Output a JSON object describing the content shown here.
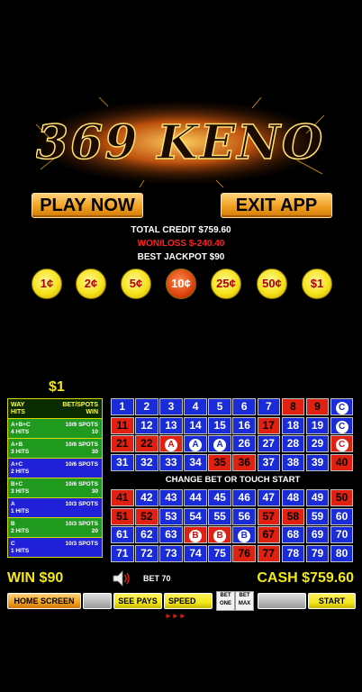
{
  "logo": {
    "text": "369 KENO"
  },
  "buttons": {
    "play_now": "PLAY NOW",
    "exit_app": "EXIT APP"
  },
  "stats": {
    "total_credit": "TOTAL CREDIT $759.60",
    "won_loss": "WON/LOSS $-240.40",
    "best_jackpot": "BEST JACKPOT $90"
  },
  "denominations": [
    {
      "label": "1¢",
      "selected": false
    },
    {
      "label": "2¢",
      "selected": false
    },
    {
      "label": "5¢",
      "selected": false
    },
    {
      "label": "10¢",
      "selected": true
    },
    {
      "label": "25¢",
      "selected": false
    },
    {
      "label": "50¢",
      "selected": false
    },
    {
      "label": "$1",
      "selected": false
    }
  ],
  "bet_amount": "$1",
  "paytable": {
    "header": {
      "left1": "WAY",
      "left2": "HITS",
      "right1": "BET/SPOTS",
      "right2": "WIN"
    },
    "rows": [
      {
        "color": "green",
        "l1": "A+B+C",
        "l2": "4 HITS",
        "r1": "10/9 SPOTS",
        "r2": "10"
      },
      {
        "color": "green",
        "l1": "A+B",
        "l2": "3 HITS",
        "r1": "10/6 SPOTS",
        "r2": "30"
      },
      {
        "color": "blue",
        "l1": "A+C",
        "l2": "2 HITS",
        "r1": "10/6 SPOTS",
        "r2": ""
      },
      {
        "color": "green",
        "l1": "B+C",
        "l2": "3 HITS",
        "r1": "10/6 SPOTS",
        "r2": "30"
      },
      {
        "color": "blue",
        "l1": "A",
        "l2": "1 HITS",
        "r1": "10/3 SPOTS",
        "r2": ""
      },
      {
        "color": "green",
        "l1": "B",
        "l2": "2 HITS",
        "r1": "10/3 SPOTS",
        "r2": "20"
      },
      {
        "color": "blue",
        "l1": "C",
        "l2": "1 HITS",
        "r1": "10/3 SPOTS",
        "r2": ""
      }
    ]
  },
  "grid_top": [
    {
      "n": "1",
      "c": "blue"
    },
    {
      "n": "2",
      "c": "blue"
    },
    {
      "n": "3",
      "c": "blue"
    },
    {
      "n": "4",
      "c": "blue"
    },
    {
      "n": "5",
      "c": "blue"
    },
    {
      "n": "6",
      "c": "blue"
    },
    {
      "n": "7",
      "c": "blue"
    },
    {
      "n": "8",
      "c": "red"
    },
    {
      "n": "9",
      "c": "red"
    },
    {
      "n": "C",
      "c": "blue",
      "mark": "b"
    },
    {
      "n": "11",
      "c": "red"
    },
    {
      "n": "12",
      "c": "blue"
    },
    {
      "n": "13",
      "c": "blue"
    },
    {
      "n": "14",
      "c": "blue"
    },
    {
      "n": "15",
      "c": "blue"
    },
    {
      "n": "16",
      "c": "blue"
    },
    {
      "n": "17",
      "c": "red"
    },
    {
      "n": "18",
      "c": "blue"
    },
    {
      "n": "19",
      "c": "blue"
    },
    {
      "n": "C",
      "c": "blue",
      "mark": "b"
    },
    {
      "n": "21",
      "c": "red"
    },
    {
      "n": "22",
      "c": "red"
    },
    {
      "n": "A",
      "c": "red",
      "mark": "r"
    },
    {
      "n": "A",
      "c": "blue",
      "mark": "b"
    },
    {
      "n": "A",
      "c": "blue",
      "mark": "b"
    },
    {
      "n": "26",
      "c": "blue"
    },
    {
      "n": "27",
      "c": "blue"
    },
    {
      "n": "28",
      "c": "blue"
    },
    {
      "n": "29",
      "c": "blue"
    },
    {
      "n": "C",
      "c": "red",
      "mark": "r"
    },
    {
      "n": "31",
      "c": "blue"
    },
    {
      "n": "32",
      "c": "blue"
    },
    {
      "n": "33",
      "c": "blue"
    },
    {
      "n": "34",
      "c": "blue"
    },
    {
      "n": "35",
      "c": "red"
    },
    {
      "n": "36",
      "c": "red"
    },
    {
      "n": "37",
      "c": "blue"
    },
    {
      "n": "38",
      "c": "blue"
    },
    {
      "n": "39",
      "c": "blue"
    },
    {
      "n": "40",
      "c": "red"
    }
  ],
  "change_message": "CHANGE BET OR TOUCH START",
  "grid_bottom": [
    {
      "n": "41",
      "c": "red"
    },
    {
      "n": "42",
      "c": "blue"
    },
    {
      "n": "43",
      "c": "blue"
    },
    {
      "n": "44",
      "c": "blue"
    },
    {
      "n": "45",
      "c": "blue"
    },
    {
      "n": "46",
      "c": "blue"
    },
    {
      "n": "47",
      "c": "blue"
    },
    {
      "n": "48",
      "c": "blue"
    },
    {
      "n": "49",
      "c": "blue"
    },
    {
      "n": "50",
      "c": "red"
    },
    {
      "n": "51",
      "c": "red"
    },
    {
      "n": "52",
      "c": "red"
    },
    {
      "n": "53",
      "c": "blue"
    },
    {
      "n": "54",
      "c": "blue"
    },
    {
      "n": "55",
      "c": "blue"
    },
    {
      "n": "56",
      "c": "blue"
    },
    {
      "n": "57",
      "c": "red"
    },
    {
      "n": "58",
      "c": "red"
    },
    {
      "n": "59",
      "c": "blue"
    },
    {
      "n": "60",
      "c": "blue"
    },
    {
      "n": "61",
      "c": "blue"
    },
    {
      "n": "62",
      "c": "blue"
    },
    {
      "n": "63",
      "c": "blue"
    },
    {
      "n": "B",
      "c": "red",
      "mark": "r"
    },
    {
      "n": "B",
      "c": "red",
      "mark": "r"
    },
    {
      "n": "B",
      "c": "blue",
      "mark": "b"
    },
    {
      "n": "67",
      "c": "red"
    },
    {
      "n": "68",
      "c": "blue"
    },
    {
      "n": "69",
      "c": "blue"
    },
    {
      "n": "70",
      "c": "blue"
    },
    {
      "n": "71",
      "c": "blue"
    },
    {
      "n": "72",
      "c": "blue"
    },
    {
      "n": "73",
      "c": "blue"
    },
    {
      "n": "74",
      "c": "blue"
    },
    {
      "n": "75",
      "c": "blue"
    },
    {
      "n": "76",
      "c": "red"
    },
    {
      "n": "77",
      "c": "red"
    },
    {
      "n": "78",
      "c": "blue"
    },
    {
      "n": "79",
      "c": "blue"
    },
    {
      "n": "80",
      "c": "blue"
    }
  ],
  "status": {
    "win": "WIN  $90",
    "bet": "BET 70",
    "cash": "CASH  $759.60"
  },
  "controls": {
    "home_screen": "HOME SCREEN",
    "see_pays": "SEE PAYS",
    "speed": "SPEED",
    "bet_one_1": "BET",
    "bet_one_2": "ONE",
    "bet_max_1": "BET",
    "bet_max_2": "MAX",
    "start": "START"
  },
  "colors": {
    "yellow_text": "#f2e81a",
    "grid_blue": "#1a2bd8",
    "grid_red": "#e02010",
    "won_loss_red": "#ff2020"
  }
}
